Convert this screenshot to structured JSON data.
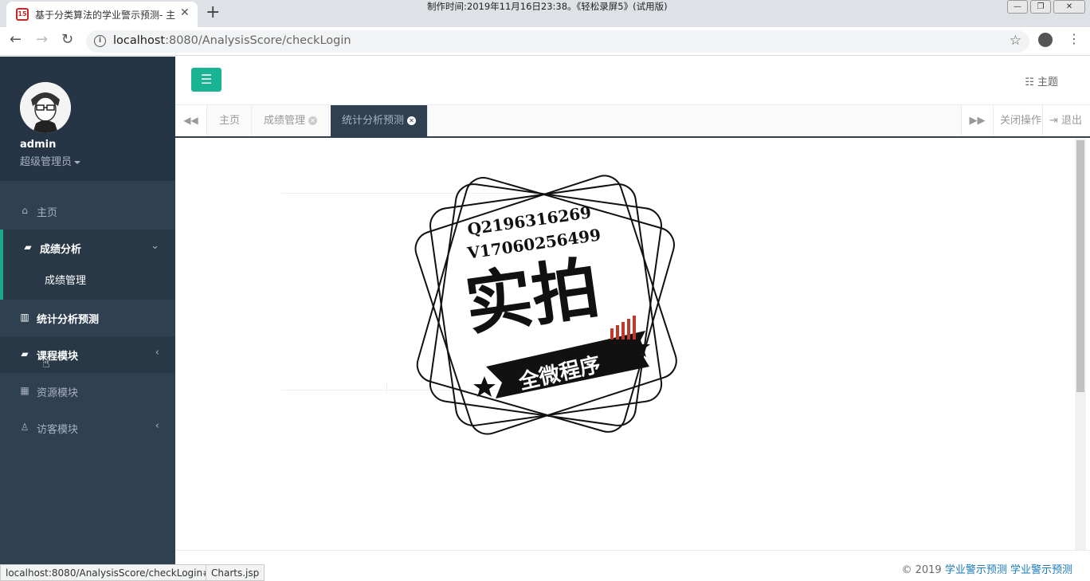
{
  "browser": {
    "tab_title": "基于分类算法的学业警示预测- 主",
    "url_host": "localhost",
    "url_path": ":8080/AnalysisScore/checkLogin",
    "watermark": "制作时间:2019年11月16日23:38。《轻松录屏5》(试用版)",
    "favicon_text": "15"
  },
  "user": {
    "name": "admin",
    "role": "超级管理员"
  },
  "sidebar": {
    "items": [
      {
        "label": "主页",
        "icon": "home-icon"
      },
      {
        "label": "成绩分析",
        "icon": "book-icon"
      },
      {
        "label": "统计分析预测",
        "icon": "bar-chart-icon"
      },
      {
        "label": "课程模块",
        "icon": "book-icon"
      },
      {
        "label": "资源模块",
        "icon": "table-icon"
      },
      {
        "label": "访客模块",
        "icon": "user-icon"
      }
    ],
    "sub_items": [
      {
        "label": "成绩管理"
      }
    ]
  },
  "topbar": {
    "theme_label": "主题",
    "accent_color": "#1ab394"
  },
  "tabs": {
    "items": [
      {
        "label": "主页"
      },
      {
        "label": "成绩管理"
      },
      {
        "label": "统计分析预测"
      }
    ],
    "close_ops_label": "关闭操作",
    "logout_label": "退出"
  },
  "stamp": {
    "line1": "Q2196316269",
    "line2": "V17060256499",
    "big": "实拍",
    "banner": "全微程序"
  },
  "footer": {
    "copyright": "© 2019",
    "link1": "学业警示预测",
    "link2": "学业警示预测"
  },
  "status": {
    "link_url": "localhost:8080/AnalysisScore/checkLogin#",
    "page": "Charts.jsp"
  }
}
